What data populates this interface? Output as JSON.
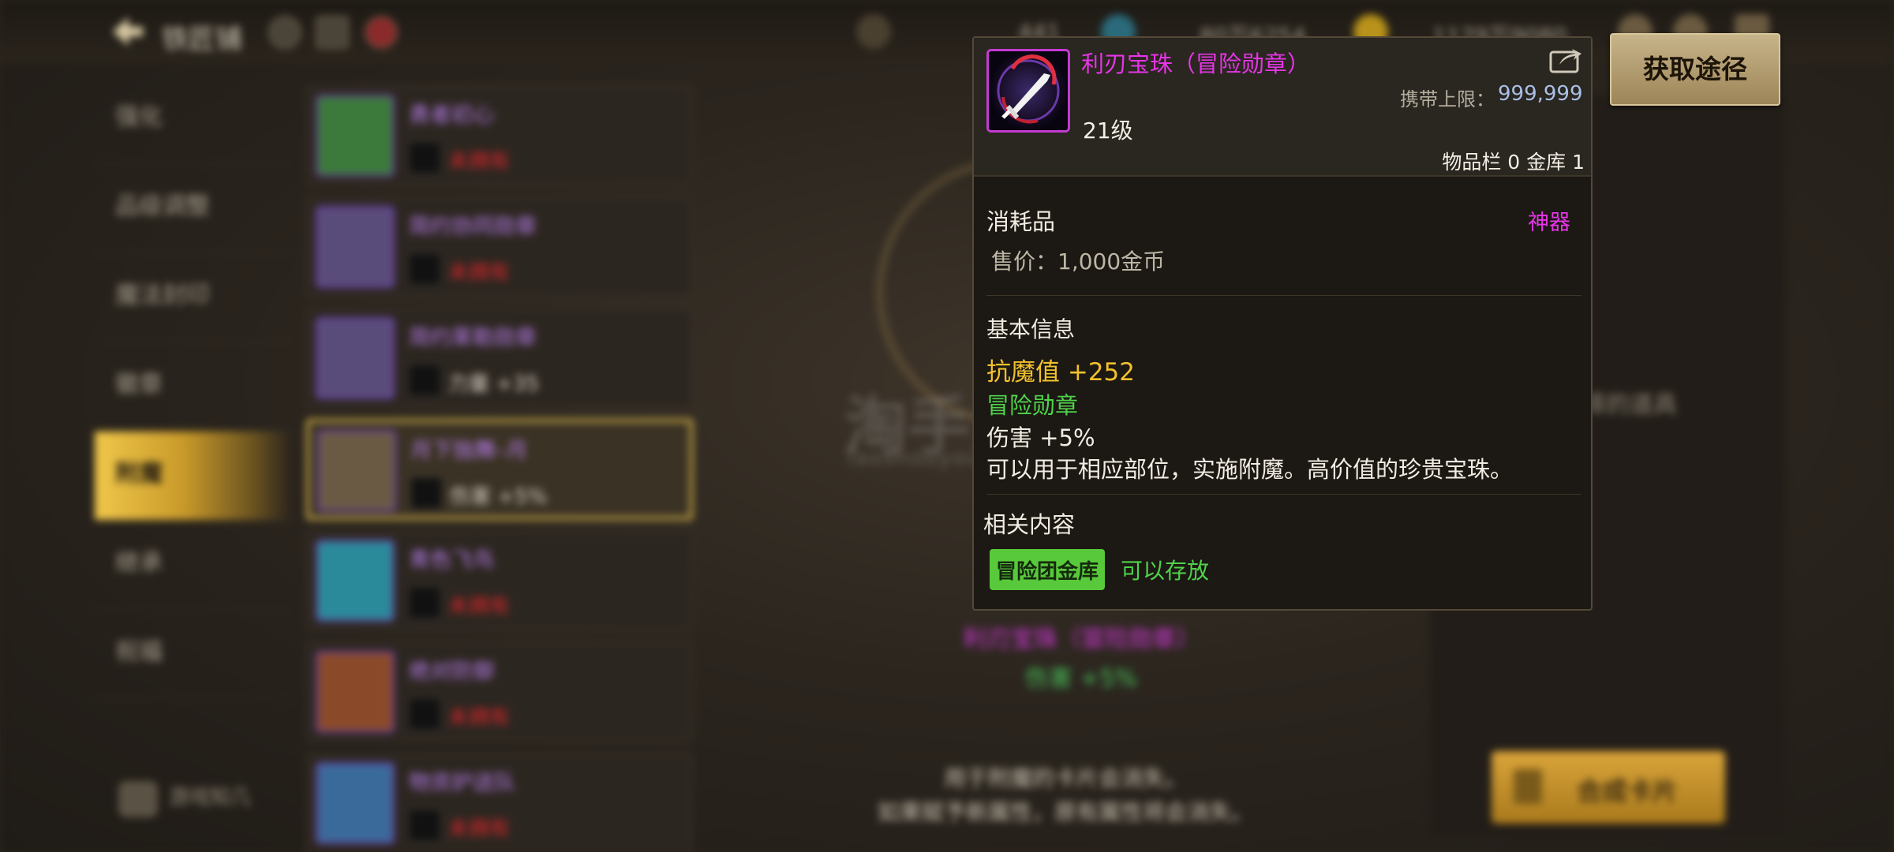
{
  "header": {
    "title": "铁匠铺",
    "currency_1": "441",
    "currency_2": "80万6254",
    "currency_3": "1179万9080"
  },
  "side_menu": [
    {
      "label": "强化"
    },
    {
      "label": "品级调整"
    },
    {
      "label": "魔法封印"
    },
    {
      "label": "徽章"
    },
    {
      "label": "附魔"
    },
    {
      "label": "继承"
    },
    {
      "label": "祝福"
    }
  ],
  "game_tips": "游戏知几",
  "cards": [
    {
      "name": "勇者初心",
      "stat": "未拥有",
      "stat_type": "red",
      "thumb_color": "#3b7a3a"
    },
    {
      "name": "简约协同勋章",
      "stat": "未拥有",
      "stat_type": "red",
      "thumb_color": "#5a4c7a"
    },
    {
      "name": "简约莱勒勋章",
      "stat": "力量 +35",
      "stat_type": "white",
      "thumb_color": "#5a4c7a"
    },
    {
      "name": "月下独舞–月",
      "stat": "伤害 +5%",
      "stat_type": "white",
      "thumb_color": "#6a5a44"
    },
    {
      "name": "青色飞鸟",
      "stat": "未拥有",
      "stat_type": "red",
      "thumb_color": "#2a8a9a"
    },
    {
      "name": "绝对防御",
      "stat": "未拥有",
      "stat_type": "red",
      "thumb_color": "#8a4a2a"
    },
    {
      "name": "物资护送队",
      "stat": "未拥有",
      "stat_type": "red",
      "thumb_color": "#3a6a9a"
    }
  ],
  "center": {
    "item_name": "利刃宝珠（冒险勋章）",
    "item_stat": "伤害 +5%",
    "desc_line1": "用于附魔的卡片会消失。",
    "desc_line2": "如果赋予新属性，原有属性将会消失。"
  },
  "right_panel": {
    "hint": "没有可以选择的道具",
    "synth_button": "合成卡片"
  },
  "watermark": {
    "cn": "淘手游",
    "en": "Taoshouyou"
  },
  "tooltip": {
    "name": "利刃宝珠（冒险勋章）",
    "carry_limit_label": "携带上限：",
    "carry_limit_value": "999,999",
    "level": "21级",
    "storage": "物品栏 0 金库 1",
    "type": "消耗品",
    "rarity": "神器",
    "price": "售价：1,000金币",
    "basic_info_title": "基本信息",
    "magic_resist": "抗魔值 +252",
    "tag": "冒险勋章",
    "damage": "伤害 +5%",
    "description": "可以用于相应部位，实施附魔。高价值的珍贵宝珠。",
    "related_title": "相关内容",
    "badge": "冒险团金库",
    "storable": "可以存放"
  },
  "source_button": "获取途径"
}
